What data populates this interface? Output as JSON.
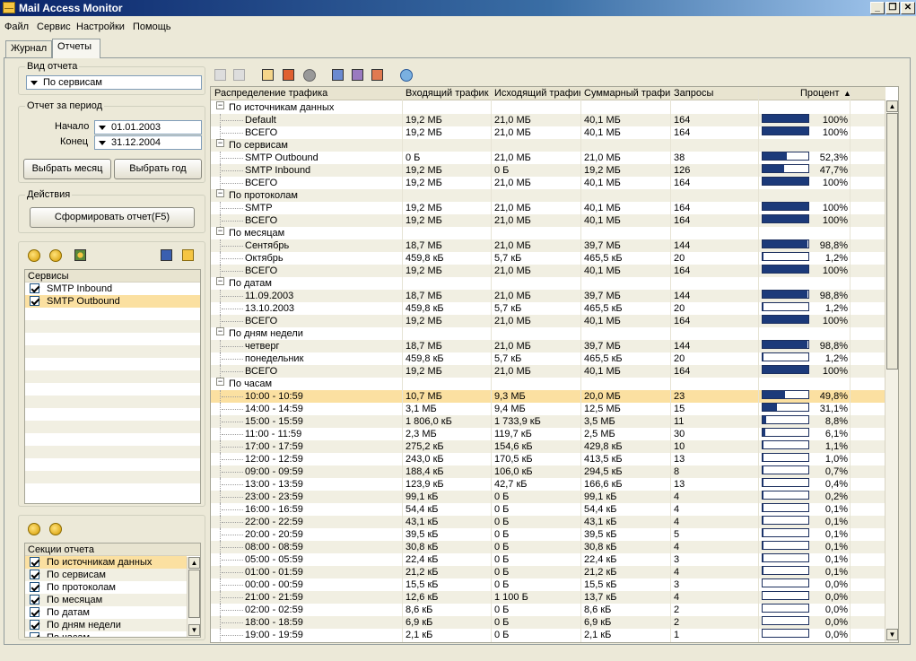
{
  "window": {
    "title": "Mail Access Monitor"
  },
  "menu": [
    "Файл",
    "Сервис",
    "Настройки",
    "Помощь"
  ],
  "tabs": [
    "Журнал",
    "Отчеты"
  ],
  "report_type": {
    "title": "Вид отчета",
    "value": "По сервисам"
  },
  "period": {
    "title": "Отчет за период",
    "start_label": "Начало",
    "start_value": "01.01.2003",
    "end_label": "Конец",
    "end_value": "31.12.2004",
    "month_button": "Выбрать месяц",
    "year_button": "Выбрать год"
  },
  "actions": {
    "title": "Действия",
    "generate_button": "Сформировать отчет(F5)"
  },
  "services": {
    "header": "Сервисы",
    "items": [
      {
        "label": "SMTP Inbound",
        "checked": true,
        "selected": false
      },
      {
        "label": "SMTP Outbound",
        "checked": true,
        "selected": true
      }
    ]
  },
  "sections": {
    "header": "Секции отчета",
    "items": [
      {
        "label": "По источникам данных",
        "checked": true,
        "selected": true
      },
      {
        "label": "По сервисам",
        "checked": true,
        "selected": false
      },
      {
        "label": "По протоколам",
        "checked": true,
        "selected": false
      },
      {
        "label": "По месяцам",
        "checked": true,
        "selected": false
      },
      {
        "label": "По датам",
        "checked": true,
        "selected": false
      },
      {
        "label": "По дням недели",
        "checked": true,
        "selected": false
      },
      {
        "label": "По часам",
        "checked": true,
        "selected": false
      }
    ]
  },
  "grid": {
    "columns": [
      "Распределение трафика",
      "Входящий трафик",
      "Исходящий трафик",
      "Суммарный трафик",
      "Запросы",
      "",
      "Процент"
    ],
    "rows": [
      {
        "type": "group",
        "label": "По источникам данных"
      },
      {
        "label": "Default",
        "in": "19,2 МБ",
        "out": "21,0 МБ",
        "sum": "40,1 МБ",
        "req": "164",
        "pct": 100,
        "pct_text": "100%"
      },
      {
        "label": "ВСЕГО",
        "in": "19,2 МБ",
        "out": "21,0 МБ",
        "sum": "40,1 МБ",
        "req": "164",
        "pct": 100,
        "pct_text": "100%"
      },
      {
        "type": "group",
        "label": "По сервисам"
      },
      {
        "label": "SMTP Outbound",
        "in": "0 Б",
        "out": "21,0 МБ",
        "sum": "21,0 МБ",
        "req": "38",
        "pct": 52.3,
        "pct_text": "52,3%"
      },
      {
        "label": "SMTP Inbound",
        "in": "19,2 МБ",
        "out": "0 Б",
        "sum": "19,2 МБ",
        "req": "126",
        "pct": 47.7,
        "pct_text": "47,7%"
      },
      {
        "label": "ВСЕГО",
        "in": "19,2 МБ",
        "out": "21,0 МБ",
        "sum": "40,1 МБ",
        "req": "164",
        "pct": 100,
        "pct_text": "100%"
      },
      {
        "type": "group",
        "label": "По протоколам"
      },
      {
        "label": "SMTP",
        "in": "19,2 МБ",
        "out": "21,0 МБ",
        "sum": "40,1 МБ",
        "req": "164",
        "pct": 100,
        "pct_text": "100%"
      },
      {
        "label": "ВСЕГО",
        "in": "19,2 МБ",
        "out": "21,0 МБ",
        "sum": "40,1 МБ",
        "req": "164",
        "pct": 100,
        "pct_text": "100%"
      },
      {
        "type": "group",
        "label": "По месяцам"
      },
      {
        "label": "Сентябрь",
        "in": "18,7 МБ",
        "out": "21,0 МБ",
        "sum": "39,7 МБ",
        "req": "144",
        "pct": 98.8,
        "pct_text": "98,8%"
      },
      {
        "label": "Октябрь",
        "in": "459,8 кБ",
        "out": "5,7 кБ",
        "sum": "465,5 кБ",
        "req": "20",
        "pct": 1.2,
        "pct_text": "1,2%"
      },
      {
        "label": "ВСЕГО",
        "in": "19,2 МБ",
        "out": "21,0 МБ",
        "sum": "40,1 МБ",
        "req": "164",
        "pct": 100,
        "pct_text": "100%"
      },
      {
        "type": "group",
        "label": "По датам"
      },
      {
        "label": "11.09.2003",
        "in": "18,7 МБ",
        "out": "21,0 МБ",
        "sum": "39,7 МБ",
        "req": "144",
        "pct": 98.8,
        "pct_text": "98,8%"
      },
      {
        "label": "13.10.2003",
        "in": "459,8 кБ",
        "out": "5,7 кБ",
        "sum": "465,5 кБ",
        "req": "20",
        "pct": 1.2,
        "pct_text": "1,2%"
      },
      {
        "label": "ВСЕГО",
        "in": "19,2 МБ",
        "out": "21,0 МБ",
        "sum": "40,1 МБ",
        "req": "164",
        "pct": 100,
        "pct_text": "100%"
      },
      {
        "type": "group",
        "label": "По дням недели"
      },
      {
        "label": "четверг",
        "in": "18,7 МБ",
        "out": "21,0 МБ",
        "sum": "39,7 МБ",
        "req": "144",
        "pct": 98.8,
        "pct_text": "98,8%"
      },
      {
        "label": "понедельник",
        "in": "459,8 кБ",
        "out": "5,7 кБ",
        "sum": "465,5 кБ",
        "req": "20",
        "pct": 1.2,
        "pct_text": "1,2%"
      },
      {
        "label": "ВСЕГО",
        "in": "19,2 МБ",
        "out": "21,0 МБ",
        "sum": "40,1 МБ",
        "req": "164",
        "pct": 100,
        "pct_text": "100%"
      },
      {
        "type": "group",
        "label": "По часам"
      },
      {
        "label": "10:00 - 10:59",
        "in": "10,7 МБ",
        "out": "9,3 МБ",
        "sum": "20,0 МБ",
        "req": "23",
        "pct": 49.8,
        "pct_text": "49,8%",
        "selected": true
      },
      {
        "label": "14:00 - 14:59",
        "in": "3,1 МБ",
        "out": "9,4 МБ",
        "sum": "12,5 МБ",
        "req": "15",
        "pct": 31.1,
        "pct_text": "31,1%"
      },
      {
        "label": "15:00 - 15:59",
        "in": "1 806,0 кБ",
        "out": "1 733,9 кБ",
        "sum": "3,5 МБ",
        "req": "11",
        "pct": 8.8,
        "pct_text": "8,8%"
      },
      {
        "label": "11:00 - 11:59",
        "in": "2,3 МБ",
        "out": "119,7 кБ",
        "sum": "2,5 МБ",
        "req": "30",
        "pct": 6.1,
        "pct_text": "6,1%"
      },
      {
        "label": "17:00 - 17:59",
        "in": "275,2 кБ",
        "out": "154,6 кБ",
        "sum": "429,8 кБ",
        "req": "10",
        "pct": 1.1,
        "pct_text": "1,1%"
      },
      {
        "label": "12:00 - 12:59",
        "in": "243,0 кБ",
        "out": "170,5 кБ",
        "sum": "413,5 кБ",
        "req": "13",
        "pct": 1.0,
        "pct_text": "1,0%"
      },
      {
        "label": "09:00 - 09:59",
        "in": "188,4 кБ",
        "out": "106,0 кБ",
        "sum": "294,5 кБ",
        "req": "8",
        "pct": 0.7,
        "pct_text": "0,7%"
      },
      {
        "label": "13:00 - 13:59",
        "in": "123,9 кБ",
        "out": "42,7 кБ",
        "sum": "166,6 кБ",
        "req": "13",
        "pct": 0.4,
        "pct_text": "0,4%"
      },
      {
        "label": "23:00 - 23:59",
        "in": "99,1 кБ",
        "out": "0 Б",
        "sum": "99,1 кБ",
        "req": "4",
        "pct": 0.2,
        "pct_text": "0,2%"
      },
      {
        "label": "16:00 - 16:59",
        "in": "54,4 кБ",
        "out": "0 Б",
        "sum": "54,4 кБ",
        "req": "4",
        "pct": 0.1,
        "pct_text": "0,1%"
      },
      {
        "label": "22:00 - 22:59",
        "in": "43,1 кБ",
        "out": "0 Б",
        "sum": "43,1 кБ",
        "req": "4",
        "pct": 0.1,
        "pct_text": "0,1%"
      },
      {
        "label": "20:00 - 20:59",
        "in": "39,5 кБ",
        "out": "0 Б",
        "sum": "39,5 кБ",
        "req": "5",
        "pct": 0.1,
        "pct_text": "0,1%"
      },
      {
        "label": "08:00 - 08:59",
        "in": "30,8 кБ",
        "out": "0 Б",
        "sum": "30,8 кБ",
        "req": "4",
        "pct": 0.1,
        "pct_text": "0,1%"
      },
      {
        "label": "05:00 - 05:59",
        "in": "22,4 кБ",
        "out": "0 Б",
        "sum": "22,4 кБ",
        "req": "3",
        "pct": 0.1,
        "pct_text": "0,1%"
      },
      {
        "label": "01:00 - 01:59",
        "in": "21,2 кБ",
        "out": "0 Б",
        "sum": "21,2 кБ",
        "req": "4",
        "pct": 0.1,
        "pct_text": "0,1%"
      },
      {
        "label": "00:00 - 00:59",
        "in": "15,5 кБ",
        "out": "0 Б",
        "sum": "15,5 кБ",
        "req": "3",
        "pct": 0.0,
        "pct_text": "0,0%"
      },
      {
        "label": "21:00 - 21:59",
        "in": "12,6 кБ",
        "out": "1 100 Б",
        "sum": "13,7 кБ",
        "req": "4",
        "pct": 0.0,
        "pct_text": "0,0%"
      },
      {
        "label": "02:00 - 02:59",
        "in": "8,6 кБ",
        "out": "0 Б",
        "sum": "8,6 кБ",
        "req": "2",
        "pct": 0.0,
        "pct_text": "0,0%"
      },
      {
        "label": "18:00 - 18:59",
        "in": "6,9 кБ",
        "out": "0 Б",
        "sum": "6,9 кБ",
        "req": "2",
        "pct": 0.0,
        "pct_text": "0,0%"
      },
      {
        "label": "19:00 - 19:59",
        "in": "2,1 кБ",
        "out": "0 Б",
        "sum": "2,1 кБ",
        "req": "1",
        "pct": 0.0,
        "pct_text": "0,0%"
      }
    ]
  },
  "colors": {
    "selection": "#fbe0a1",
    "bar": "#1c3a7a",
    "title_bar": "#0a246a"
  }
}
